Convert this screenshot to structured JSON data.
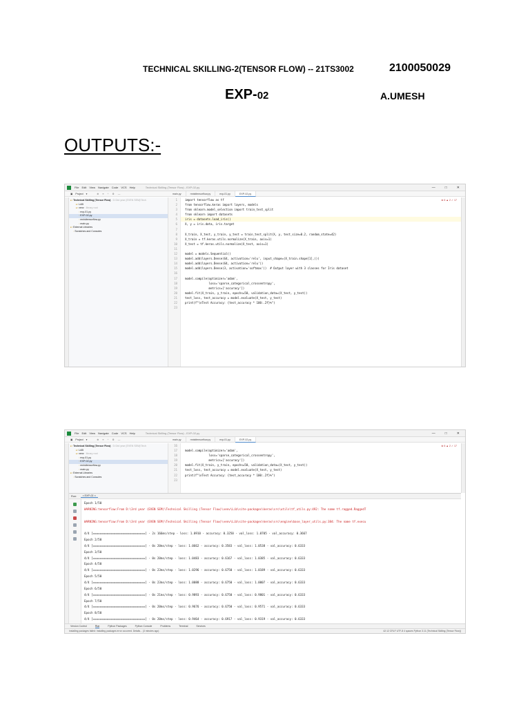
{
  "header": {
    "course": "TECHNICAL SKILLING-2(TENSOR FLOW) -- 21TS3002",
    "roll_number": "2100050029",
    "exp_main": "EXP-",
    "exp_num": "02",
    "student_name": "A.UMESH",
    "section_title": "OUTPUTS:-"
  },
  "ide": {
    "menu": [
      "File",
      "Edit",
      "View",
      "Navigate",
      "Code",
      "VCS",
      "Help"
    ],
    "window_title": "Technical Skilling (Tensor Flow) - EXP-02.py",
    "project_label": "Project",
    "editor_tabs": [
      "main.py",
      "mnisttensorflow.py",
      "exp-01.py",
      "EXP-02.py"
    ],
    "active_tab": "EXP-02.py",
    "project_tree": [
      {
        "label": "Technical Skilling (Tensor Flow)",
        "hint": "D:\\3rd year (EVEN SEM)\\Tech"
      },
      {
        "label": "LAB",
        "hint": ""
      },
      {
        "label": "venv",
        "hint": "library root"
      },
      {
        "label": "exp-01.py",
        "hint": ""
      },
      {
        "label": "EXP-02.py",
        "hint": ""
      },
      {
        "label": "mnisttensorflow.py",
        "hint": ""
      },
      {
        "label": "main.py",
        "hint": ""
      },
      {
        "label": "External Libraries",
        "hint": ""
      },
      {
        "label": "Scratches and Consoles",
        "hint": ""
      }
    ],
    "inspection": "⊗ 6  ▲ 2  ✓ 17",
    "code_lines_1": [
      {
        "n": "1",
        "t": "import tensorflow as tf"
      },
      {
        "n": "2",
        "t": "from tensorflow.keras import layers, models"
      },
      {
        "n": "3",
        "t": "from sklearn.model_selection import train_test_split"
      },
      {
        "n": "4",
        "t": "from sklearn import datasets"
      },
      {
        "n": "5",
        "t": "iris = datasets.load_iris()"
      },
      {
        "n": "6",
        "t": "X, y = iris.data, iris.target"
      },
      {
        "n": "7",
        "t": ""
      },
      {
        "n": "8",
        "t": "X_train, X_test, y_train, y_test = train_test_split(X, y, test_size=0.2, random_state=42)"
      },
      {
        "n": "9",
        "t": "X_train = tf.keras.utils.normalize(X_train, axis=1)"
      },
      {
        "n": "10",
        "t": "X_test = tf.keras.utils.normalize(X_test, axis=1)"
      },
      {
        "n": "11",
        "t": ""
      },
      {
        "n": "12",
        "t": "model = models.Sequential()"
      },
      {
        "n": "13",
        "t": "model.add(layers.Dense(64, activation='relu', input_shape=(X_train.shape[1],)))"
      },
      {
        "n": "14",
        "t": "model.add(layers.Dense(64, activation='relu'))"
      },
      {
        "n": "15",
        "t": "model.add(layers.Dense(3, activation='softmax'))  # Output layer with 3 classes for Iris dataset"
      },
      {
        "n": "16",
        "t": ""
      },
      {
        "n": "17",
        "t": "model.compile(optimizer='adam',"
      },
      {
        "n": "18",
        "t": "              loss='sparse_categorical_crossentropy',"
      },
      {
        "n": "19",
        "t": "              metrics=['accuracy'])"
      },
      {
        "n": "20",
        "t": "model.fit(X_train, y_train, epochs=50, validation_data=(X_test, y_test))"
      },
      {
        "n": "21",
        "t": "test_loss, test_accuracy = model.evaluate(X_test, y_test)"
      },
      {
        "n": "22",
        "t": "print(f\"\\nTest Accuracy: {test_accuracy * 100:.2f}%\")"
      },
      {
        "n": "23",
        "t": ""
      }
    ],
    "code_lines_2": [
      {
        "n": "16",
        "t": ""
      },
      {
        "n": "17",
        "t": "model.compile(optimizer='adam',"
      },
      {
        "n": "18",
        "t": "              loss='sparse_categorical_crossentropy',"
      },
      {
        "n": "19",
        "t": "              metrics=['accuracy'])"
      },
      {
        "n": "20",
        "t": "model.fit(X_train, y_train, epochs=50, validation_data=(X_test, y_test))"
      },
      {
        "n": "21",
        "t": "test_loss, test_accuracy = model.evaluate(X_test, y_test)"
      },
      {
        "n": "22",
        "t": "print(f\"\\nTest Accuracy: {test_accuracy * 100:.2f}%\")"
      },
      {
        "n": "23",
        "t": ""
      }
    ],
    "run_label": "Run:",
    "run_tab": "EXP-02",
    "console": [
      {
        "t": "Epoch 1/50",
        "err": false
      },
      {
        "t": "WARNING:tensorflow:From D:\\3rd year (EVEN SEM)\\Technical Skilling (Tensor Flow)\\venv\\Lib\\site-packages\\keras\\src\\utils\\tf_utils.py:492: The name tf.ragged.RaggedT",
        "err": true
      },
      {
        "t": "",
        "err": false
      },
      {
        "t": "WARNING:tensorflow:From D:\\3rd year (EVEN SEM)\\Technical Skilling (Tensor Flow)\\venv\\Lib\\site-packages\\keras\\src\\engine\\base_layer_utils.py:384: The name tf.execu",
        "err": true
      },
      {
        "t": "",
        "err": false
      },
      {
        "t": "4/4 [==============================] - 2s 166ms/step - loss: 1.0910 - accuracy: 0.3250 - val_loss: 1.0705 - val_accuracy: 0.3667",
        "err": false
      },
      {
        "t": "Epoch 2/50",
        "err": false
      },
      {
        "t": "4/4 [==============================] - 0s 20ms/step - loss: 1.0662 - accuracy: 0.3583 - val_loss: 1.0538 - val_accuracy: 0.6333",
        "err": false
      },
      {
        "t": "Epoch 3/50",
        "err": false
      },
      {
        "t": "4/4 [==============================] - 0s 20ms/step - loss: 1.0483 - accuracy: 0.6167 - val_loss: 1.0385 - val_accuracy: 0.6333",
        "err": false
      },
      {
        "t": "Epoch 4/50",
        "err": false
      },
      {
        "t": "4/4 [==============================] - 0s 23ms/step - loss: 1.0296 - accuracy: 0.6750 - val_loss: 1.0189 - val_accuracy: 0.6333",
        "err": false
      },
      {
        "t": "Epoch 5/50",
        "err": false
      },
      {
        "t": "4/4 [==============================] - 0s 23ms/step - loss: 1.0088 - accuracy: 0.6750 - val_loss: 1.0007 - val_accuracy: 0.6333",
        "err": false
      },
      {
        "t": "Epoch 6/50",
        "err": false
      },
      {
        "t": "4/4 [==============================] - 0s 21ms/step - loss: 0.9893 - accuracy: 0.6750 - val_loss: 0.9801 - val_accuracy: 0.6333",
        "err": false
      },
      {
        "t": "Epoch 7/50",
        "err": false
      },
      {
        "t": "4/4 [==============================] - 0s 20ms/step - loss: 0.9676 - accuracy: 0.6750 - val_loss: 0.9571 - val_accuracy: 0.6333",
        "err": false
      },
      {
        "t": "Epoch 8/50",
        "err": false
      },
      {
        "t": "4/4 [==============================] - 0s 20ms/step - loss: 0.9464 - accuracy: 0.6917 - val_loss: 0.9319 - val_accuracy: 0.6333",
        "err": false
      }
    ],
    "bottom_tabs": [
      "Version Control",
      "Run",
      "Python Packages",
      "Python Console",
      "Problems",
      "Terminal",
      "Services"
    ],
    "status_left": "Installing packages failed: Installing packages error occurred. Details... (3 minutes ago)",
    "status_right": "42:12  CRLF  UTF-8  4 spaces  Python 3.11 (Technical Skilling (Tensor Flow))"
  }
}
